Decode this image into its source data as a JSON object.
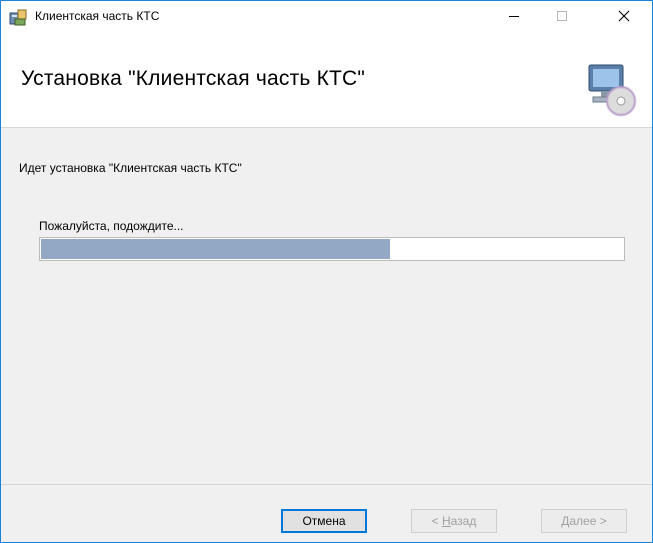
{
  "window": {
    "title": "Клиентская часть КТС",
    "controls": {
      "minimize_icon": "minimize-icon",
      "maximize_icon": "maximize-icon",
      "close_icon": "close-icon"
    }
  },
  "header": {
    "title": "Установка \"Клиентская часть КТС\"",
    "icon": "computer-disc-icon"
  },
  "body": {
    "status_text": "Идет установка \"Клиентская часть КТС\"",
    "wait_text": "Пожалуйста, подождите...",
    "progress_percent": 60
  },
  "footer": {
    "cancel_label": "Отмена",
    "back_prefix": "< ",
    "back_hotkey": "Н",
    "back_rest": "азад",
    "next_hotkey": "Д",
    "next_rest": "алее >"
  },
  "colors": {
    "accent": "#0078d7",
    "progress_fill": "#93a8c4",
    "disabled_text": "#a0a0a0"
  }
}
